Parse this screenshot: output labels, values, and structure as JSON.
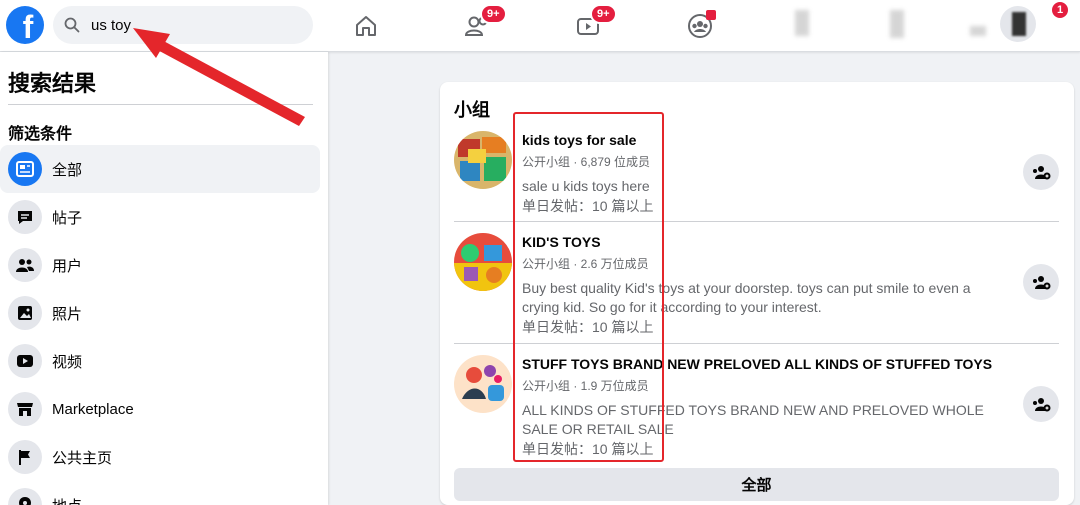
{
  "search": {
    "value": "us toy"
  },
  "nav": {
    "friends_badge": "9+",
    "watch_badge": "9+",
    "notif_badge": "1"
  },
  "sidebar": {
    "title": "搜索结果",
    "filter_heading": "筛选条件",
    "items": [
      {
        "label": "全部",
        "icon": "feed-icon"
      },
      {
        "label": "帖子",
        "icon": "posts-icon"
      },
      {
        "label": "用户",
        "icon": "people-icon"
      },
      {
        "label": "照片",
        "icon": "photos-icon"
      },
      {
        "label": "视频",
        "icon": "video-icon"
      },
      {
        "label": "Marketplace",
        "icon": "marketplace-icon"
      },
      {
        "label": "公共主页",
        "icon": "flag-icon"
      },
      {
        "label": "地点",
        "icon": "place-icon"
      }
    ]
  },
  "groups": {
    "title": "小组",
    "items": [
      {
        "name": "kids toys for sale",
        "meta": "公开小组 · 6,879 位成员",
        "desc": "sale u kids toys here",
        "posts": "单日发帖：10 篇以上"
      },
      {
        "name": "KID'S TOYS",
        "meta": "公开小组 · 2.6 万位成员",
        "desc": "Buy best quality Kid's toys at your doorstep. toys can put smile to even a crying kid. So go for it according to your interest.",
        "posts": "单日发帖：10 篇以上"
      },
      {
        "name": "STUFF TOYS BRAND NEW PRELOVED ALL KINDS OF STUFFED TOYS",
        "meta": "公开小组 · 1.9 万位成员",
        "desc": "ALL KINDS OF STUFFED TOYS BRAND NEW AND PRELOVED WHOLE SALE OR RETAIL SALE",
        "posts": "单日发帖：10 篇以上"
      }
    ],
    "see_all": "全部"
  },
  "colors": {
    "brand": "#1877f2",
    "annotation": "#e4262b"
  }
}
